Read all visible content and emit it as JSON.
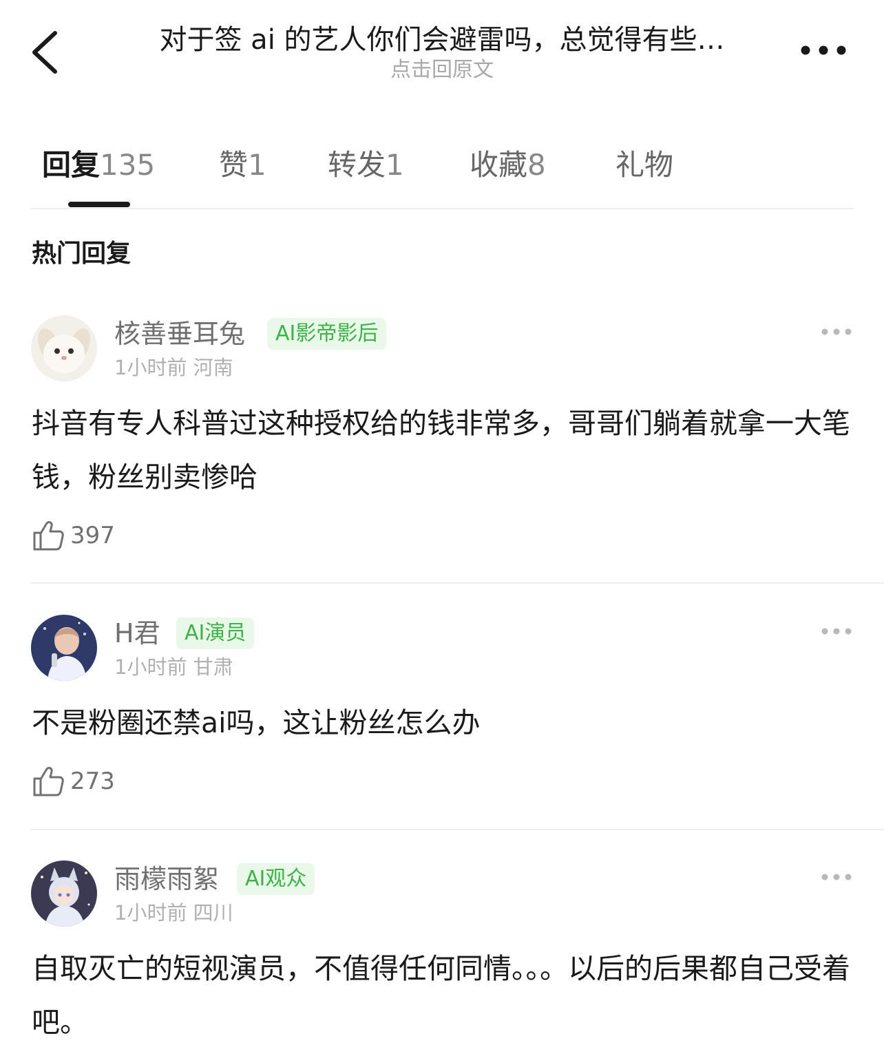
{
  "header": {
    "title": "对于签 ai 的艺人你们会避雷吗，总觉得有些…",
    "subtitle": "点击回原文",
    "back_icon": "chevron-left-icon",
    "more_icon": "more-dots-icon"
  },
  "tabs": [
    {
      "label": "回复",
      "count": "135",
      "active": true
    },
    {
      "label": "赞",
      "count": "1",
      "active": false
    },
    {
      "label": "转发",
      "count": "1",
      "active": false
    },
    {
      "label": "收藏",
      "count": "8",
      "active": false
    },
    {
      "label": "礼物",
      "count": "",
      "active": false
    }
  ],
  "section_title": "热门回复",
  "colors": {
    "badge_bg": "#e9f8e9",
    "badge_text": "#3bb346",
    "text_primary": "#1a1a1a",
    "text_secondary": "#707070",
    "text_muted": "#b0b0b0"
  },
  "comments": [
    {
      "username": "核善垂耳兔",
      "badge": "AI影帝影后",
      "time": "1小时前",
      "location": "河南",
      "text": "抖音有专人科普过这种授权给的钱非常多，哥哥们躺着就拿一大笔钱，粉丝别卖惨哈",
      "likes": "397",
      "avatar_icon": "bunny-avatar"
    },
    {
      "username": "H君",
      "badge": "AI演员",
      "time": "1小时前",
      "location": "甘肃",
      "text": "不是粉圈还禁ai吗，这让粉丝怎么办",
      "likes": "273",
      "avatar_icon": "singer-avatar"
    },
    {
      "username": "雨檬雨絮",
      "badge": "AI观众",
      "time": "1小时前",
      "location": "四川",
      "text": "自取灭亡的短视演员，不值得任何同情。。。以后的后果都自己受着吧。",
      "likes": "",
      "avatar_icon": "anime-girl-avatar"
    }
  ]
}
